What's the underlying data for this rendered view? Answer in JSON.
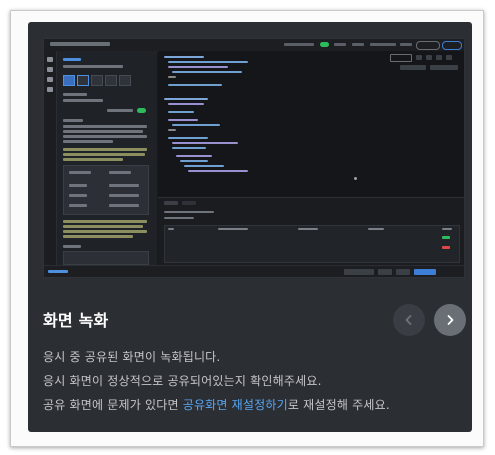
{
  "slide": {
    "title": "화면 녹화",
    "line1": "응시 중 공유된 화면이 녹화됩니다.",
    "line2": "응시 화면이 정상적으로 공유되어있는지 확인해주세요.",
    "line3_before": "공유 화면에 문제가 있다면 ",
    "line3_link": "공유화면 재설정하기",
    "line3_after": "로 재설정해 주세요."
  },
  "nav": {
    "prev_icon": "chevron-left-icon",
    "next_icon": "chevron-right-icon"
  },
  "colors": {
    "card_bg": "#2b2e33",
    "link": "#58a6f5",
    "text": "#c3c5c9",
    "toggle_on": "#2dbb5c"
  }
}
